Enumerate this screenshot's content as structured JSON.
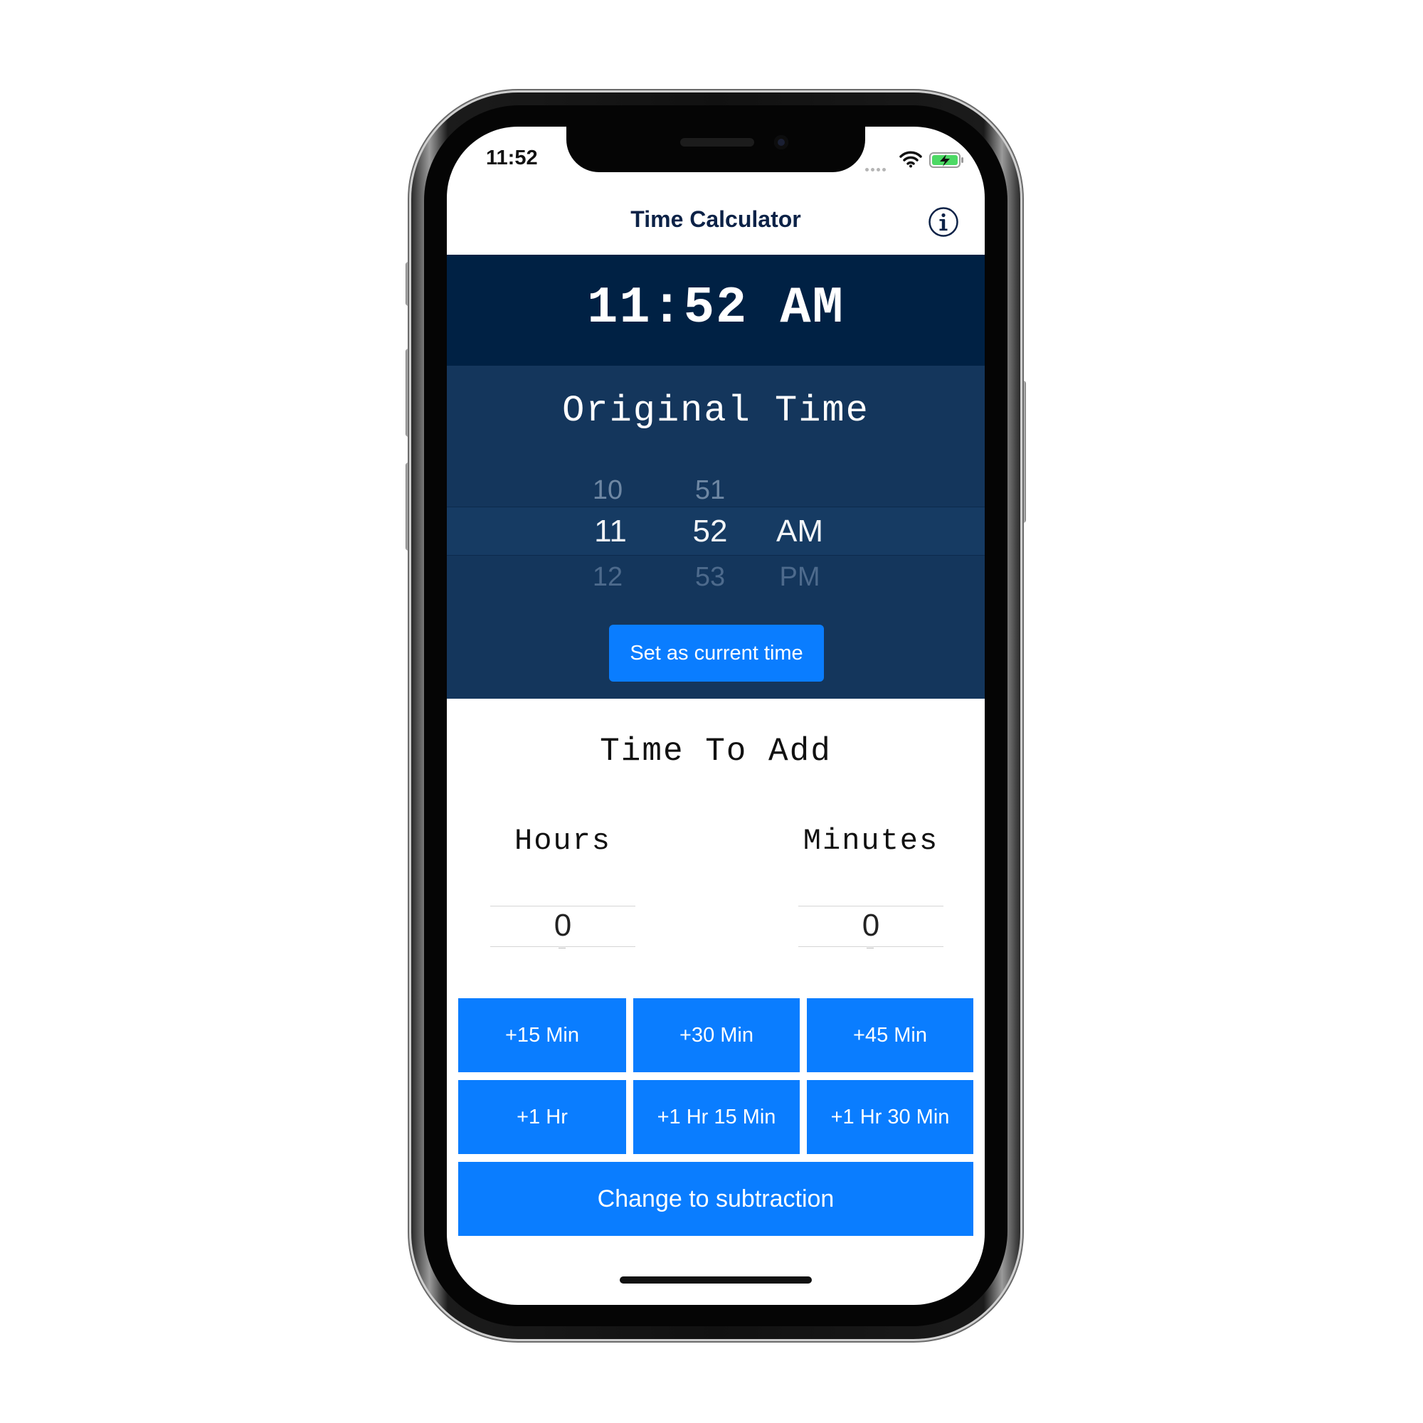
{
  "status_bar": {
    "time": "11:52"
  },
  "nav": {
    "title": "Time Calculator"
  },
  "result": {
    "time": "11:52 AM"
  },
  "original_time": {
    "title": "Original Time",
    "picker": {
      "hours": {
        "above": "10",
        "selected": "11",
        "below": "12"
      },
      "minutes": {
        "above": "51",
        "selected": "52",
        "below": "53"
      },
      "period": {
        "selected": "AM",
        "below": "PM"
      }
    },
    "set_current_label": "Set as current time"
  },
  "time_to_add": {
    "title": "Time To Add",
    "hours_label": "Hours",
    "minutes_label": "Minutes",
    "hours_value": "0",
    "minutes_value": "0"
  },
  "quick_buttons": [
    "+15 Min",
    "+30 Min",
    "+45 Min",
    "+1 Hr",
    "+1 Hr 15 Min",
    "+1 Hr 30 Min"
  ],
  "mode_button_label": "Change to subtraction",
  "colors": {
    "accent": "#0A7DFF",
    "result_band": "#002144",
    "original_band": "#14365C",
    "title_text": "#0C2247"
  },
  "icons": [
    "wifi-icon",
    "battery-charging-icon",
    "info-icon"
  ]
}
